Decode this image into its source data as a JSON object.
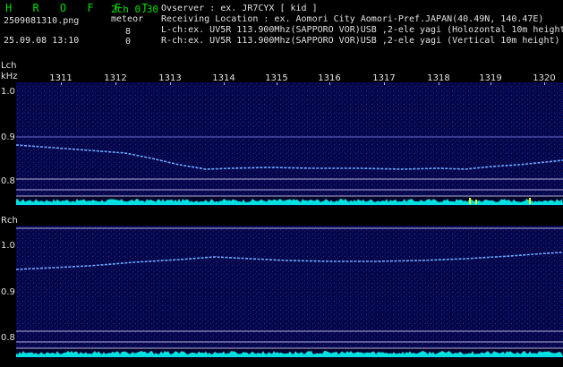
{
  "header": {
    "brand": "H R O F F T",
    "version": "2ch 0.30",
    "filename": "2509081310.png",
    "meteor_label": "meteor",
    "datetime": "25.09.08 13:10",
    "lch_count": "8",
    "rch_count": "0",
    "observer": "Ovserver              : ex. JR7CYX [ kid ]",
    "location": "Receiving Location : ex. Aomori City Aomori-Pref.JAPAN(40.49N, 140.47E)",
    "lch_info": "L-ch:ex. UV5R 113.900Mhz(SAPPORO VOR)USB ,2-ele yagi (Holozontal 10m height)",
    "rch_info": "R-ch:ex. UV5R 113.900Mhz(SAPPORO VOR)USB ,2-ele yagi (Vertical 10m height)"
  },
  "lch_panel": {
    "label": "Lch",
    "unit": "kHz",
    "yticks": [
      "1.0",
      "0.9",
      "0.8"
    ]
  },
  "rch_panel": {
    "label": "Rch",
    "yticks": [
      "1.0",
      "0.9",
      "0.8"
    ]
  },
  "time_ticks": [
    "1311",
    "1312",
    "1313",
    "1314",
    "1315",
    "1316",
    "1317",
    "1318",
    "1319",
    "1320"
  ],
  "colors": {
    "background": "#000000",
    "spectrum_bg": "#06064a",
    "signal": "#6aa8ff",
    "level_bar": "#00e0e0",
    "meteor_mark": "#ffff00",
    "text": "#e0e0e0",
    "brand": "#00e000"
  }
}
